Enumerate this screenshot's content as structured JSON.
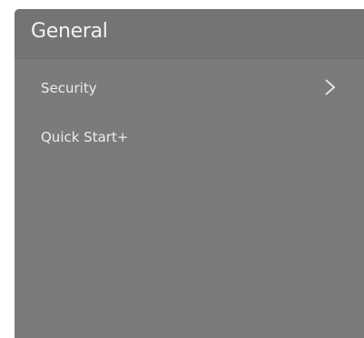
{
  "panel": {
    "title": "General",
    "items": [
      {
        "label": "Security",
        "icon": "chevron-right-icon",
        "has_submenu": true
      },
      {
        "label": "Quick Start+",
        "has_submenu": false
      }
    ]
  },
  "colors": {
    "panel_background": "#7a7b7d",
    "header_background": "#737476",
    "text": "#ececec"
  }
}
